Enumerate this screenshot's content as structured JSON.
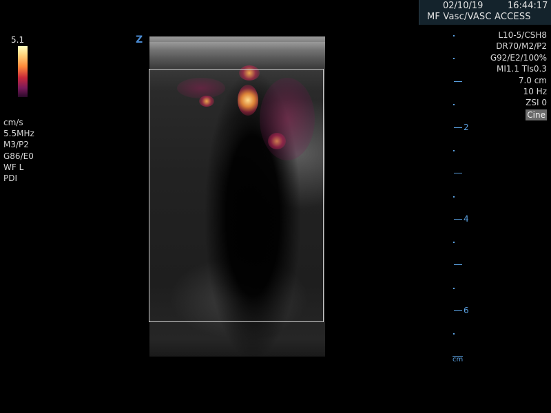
{
  "header": {
    "date": "02/10/19",
    "time": "16:44:17",
    "preset": "MF  Vasc/VASC ACCESS"
  },
  "color_scale": {
    "max_value": "5.1",
    "unit": "cm/s",
    "colors": [
      "#ffffc0",
      "#ffd27a",
      "#ff8a3a",
      "#c8283a",
      "#7a1a5a",
      "#2a0a2a"
    ]
  },
  "left_params": {
    "unit": "cm/s",
    "frequency": "5.5MHz",
    "map": "M3/P2",
    "gain": "G86/E0",
    "wall_filter": "WF L",
    "mode": "PDI"
  },
  "right_params": {
    "probe": "L10-5/CSH8",
    "dynamic_range": "DR70/M2/P2",
    "gain": "G92/E2/100%",
    "index": "MI1.1  TIs0.3",
    "depth": "7.0 cm",
    "frame_rate": "10 Hz",
    "zoom": "ZSI 0",
    "cine": "Cine"
  },
  "depth_ruler": {
    "labels": [
      "2",
      "4",
      "6"
    ],
    "unit": "cm",
    "color": "#5aa0e0"
  },
  "orientation_marker": "Z"
}
